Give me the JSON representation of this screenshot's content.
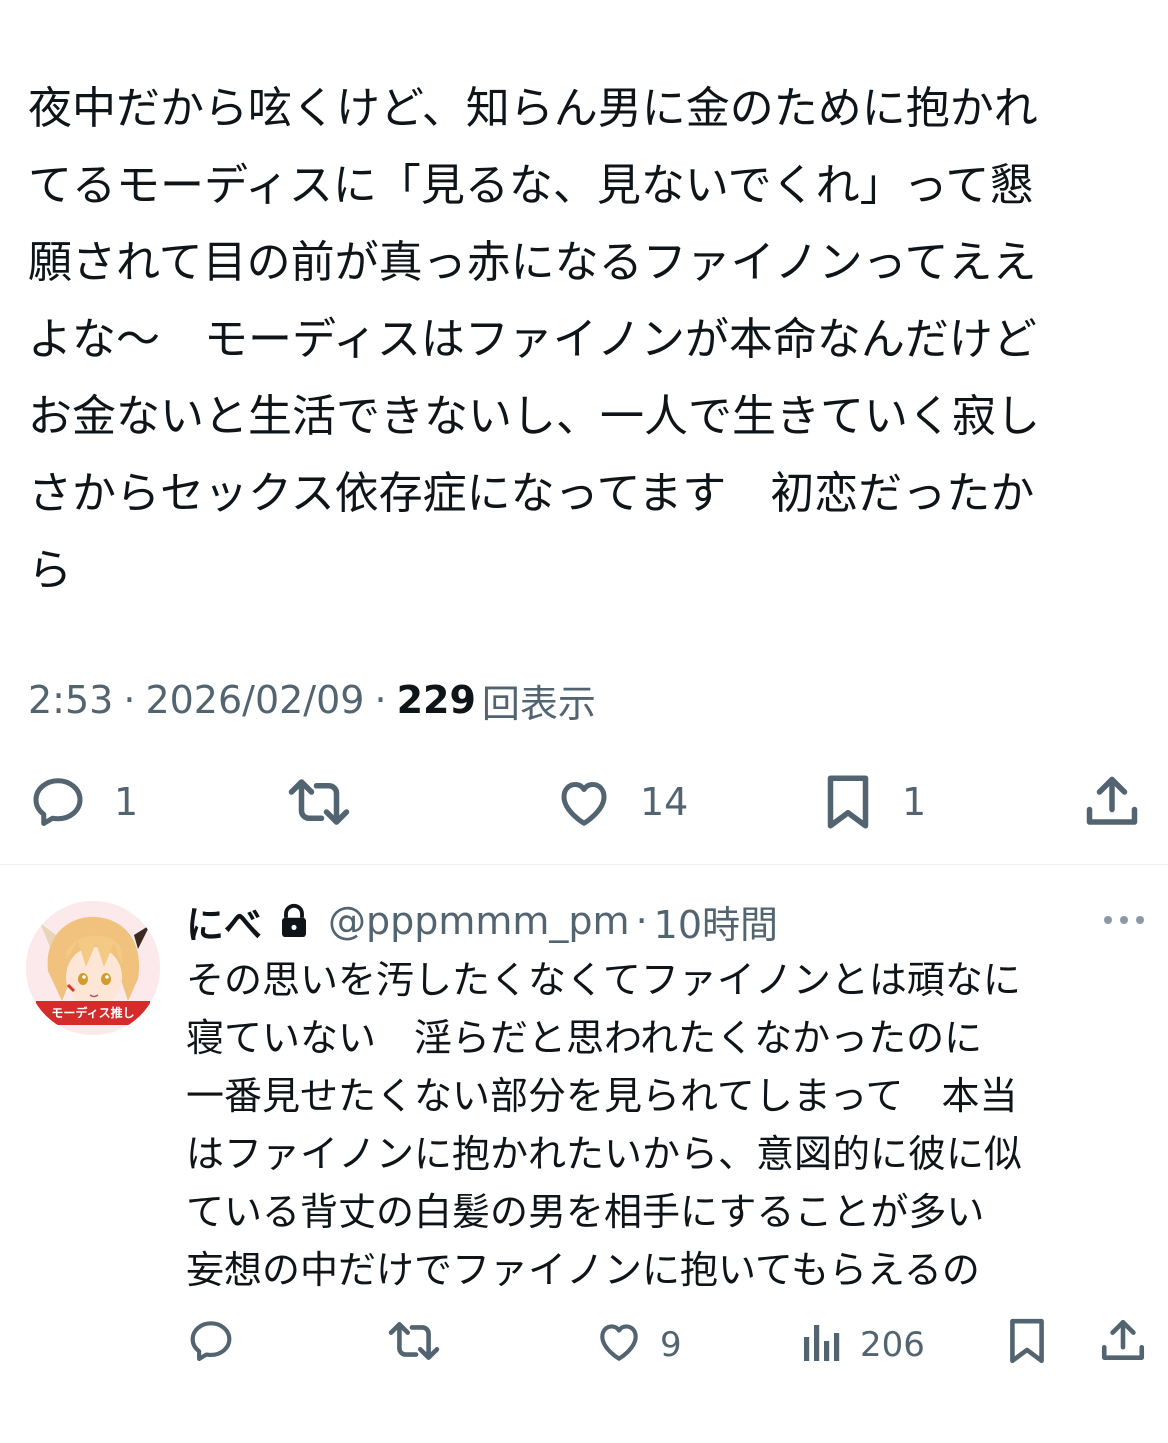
{
  "tweet": {
    "text": "夜中だから呟くけど、知らん男に金のために抱かれ\nてるモーディスに「見るな、見ないでくれ」って懇\n願されて目の前が真っ赤になるファイノンってええ\nよな〜　モーディスはファイノンが本命なんだけど\nお金ないと生活できないし、一人で生きていく寂し\nさからセックス依存症になってます　初恋だったか\nら",
    "time": "2:53",
    "date": "2026/02/09",
    "views_count": "229",
    "views_label": "回表示",
    "separator": "·",
    "actions": {
      "reply_count": "1",
      "like_count": "14",
      "bookmark_count": "1"
    }
  },
  "reply": {
    "display_name": "にべ",
    "handle": "@pppmmm_pm",
    "separator": "·",
    "time": "10時間",
    "avatar_caption": "モーディス推し",
    "text": "その思いを汚したくなくてファイノンとは頑なに\n寝ていない　淫らだと思われたくなかったのに\n一番見せたくない部分を見られてしまって　本当\nはファイノンに抱かれたいから、意図的に彼に似\nている背丈の白髪の男を相手にすることが多い\n妄想の中だけでファイノンに抱いてもらえるの",
    "actions": {
      "like_count": "9",
      "views_count": "206"
    }
  },
  "colors": {
    "text": "#0f1419",
    "secondary": "#536471",
    "divider": "#eff3f4",
    "background": "#ffffff"
  },
  "icons": [
    "reply-icon",
    "retweet-icon",
    "like-icon",
    "bookmark-icon",
    "share-icon",
    "lock-icon",
    "more-icon",
    "analytics-icon"
  ]
}
